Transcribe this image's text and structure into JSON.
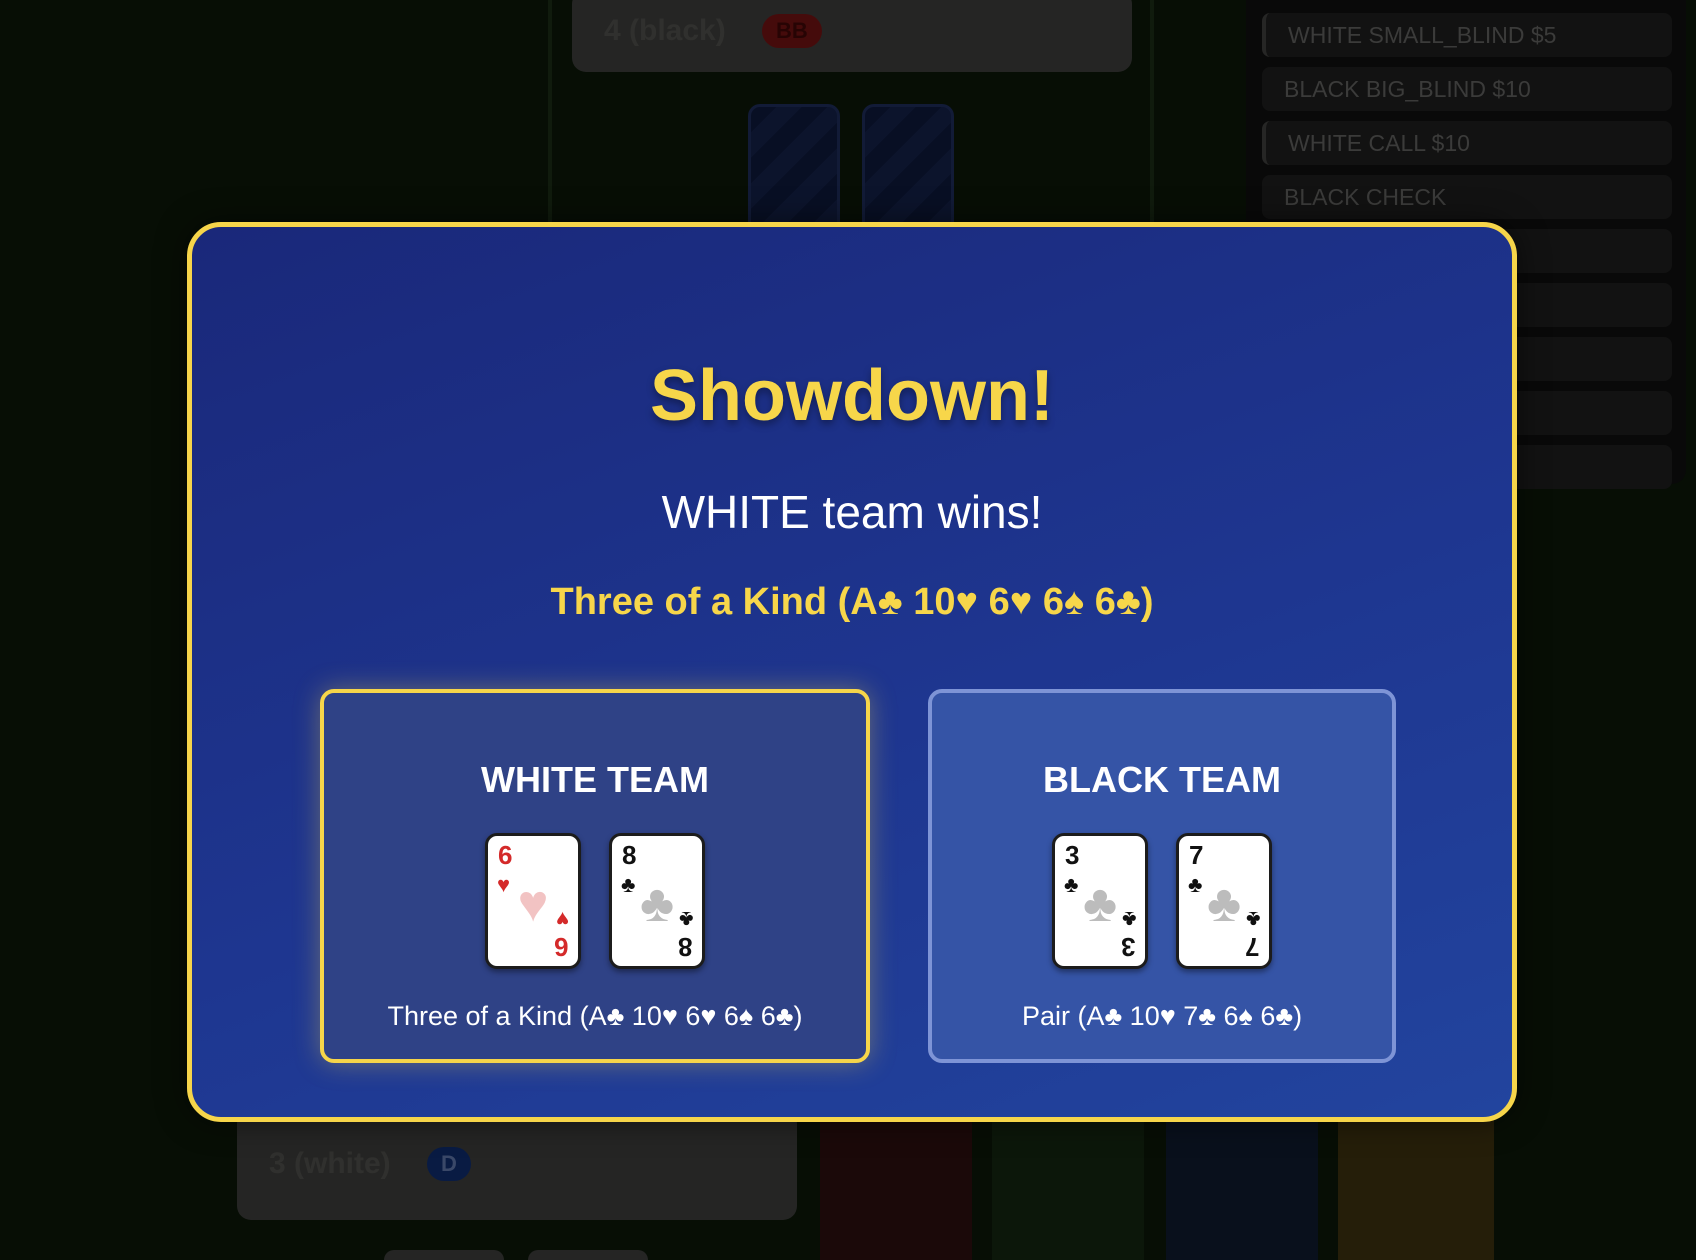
{
  "background": {
    "top_seat": {
      "name": "4 (black)",
      "badge": "BB"
    },
    "bottom_seat": {
      "name": "3 (white)",
      "badge": "D"
    },
    "action_log": [
      "WHITE SMALL_BLIND $5",
      "BLACK BIG_BLIND $10",
      "WHITE CALL $10",
      "BLACK CHECK"
    ]
  },
  "showdown": {
    "title": "Showdown!",
    "subtitle": "WHITE team wins!",
    "winning_hand": "Three of a Kind (A♣ 10♥ 6♥ 6♠ 6♣)",
    "teams": [
      {
        "name": "WHITE TEAM",
        "winner": true,
        "hand": "Three of a Kind (A♣ 10♥ 6♥ 6♠ 6♣)",
        "cards": [
          {
            "rank": "6",
            "suit": "♥",
            "color": "#d42a2a"
          },
          {
            "rank": "8",
            "suit": "♣",
            "color": "#111111"
          }
        ]
      },
      {
        "name": "BLACK TEAM",
        "winner": false,
        "hand": "Pair (A♣ 10♥ 7♣ 6♠ 6♣)",
        "cards": [
          {
            "rank": "3",
            "suit": "♣",
            "color": "#111111"
          },
          {
            "rank": "7",
            "suit": "♣",
            "color": "#111111"
          }
        ]
      }
    ]
  },
  "colors": {
    "accent_gold": "#f6d54a",
    "modal_blue": "#1e3690",
    "heart_red": "#d42a2a"
  }
}
